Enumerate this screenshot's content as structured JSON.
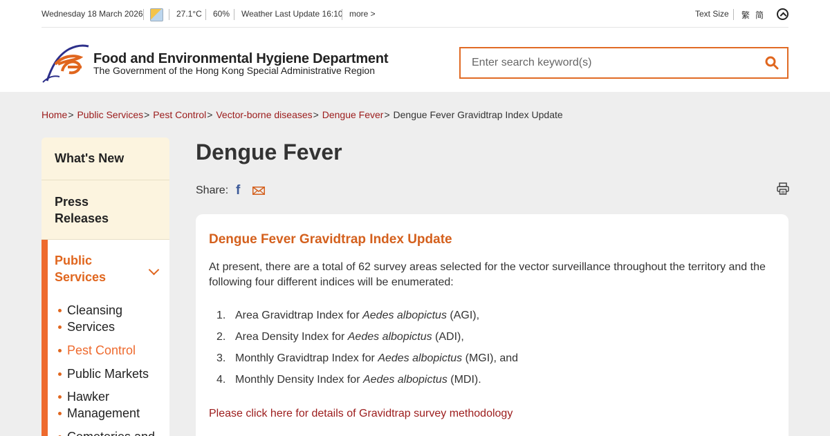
{
  "topbar": {
    "date": "Wednesday 18 March 2026",
    "weather_icon": "sunny-periods-icon",
    "temperature": "27.1°C",
    "humidity": "60%",
    "weather_update": "Weather Last Update 16:10",
    "more": "more >",
    "text_size": "Text Size",
    "lang_trad": "繁",
    "lang_simp": "简",
    "font_toggle_icon": "chevron-up-circle-icon"
  },
  "header": {
    "dept_name": "Food and Environmental Hygiene Department",
    "dept_sub": "The Government of the Hong Kong Special Administrative Region",
    "search_placeholder": "Enter search keyword(s)"
  },
  "breadcrumb": {
    "items": [
      "Home",
      "Public Services",
      "Pest Control",
      "Vector-borne diseases",
      "Dengue Fever"
    ],
    "separator": ">",
    "current": "Dengue Fever Gravidtrap Index Update"
  },
  "sidebar": {
    "whats_new": "What's New",
    "press_line1": "Press",
    "press_line2": "Releases",
    "public_line1": "Public",
    "public_line2": "Services",
    "sub_items": [
      {
        "line1": "Cleansing",
        "line2": "Services"
      },
      {
        "line1": "Pest Control"
      },
      {
        "line1": "Public Markets"
      },
      {
        "line1": "Hawker",
        "line2": "Management"
      },
      {
        "line1": "Cemeteries and"
      }
    ]
  },
  "content": {
    "page_title": "Dengue Fever",
    "share_label": "Share:",
    "card_title": "Dengue Fever Gravidtrap Index Update",
    "intro": "At present, there are a total of 62 survey areas selected for the vector surveillance throughout the territory and the following four different indices will be enumerated:",
    "indices": [
      {
        "num": "1.",
        "pre": "Area Gravidtrap Index for ",
        "species": "Aedes albopictus",
        "post": " (AGI),"
      },
      {
        "num": "2.",
        "pre": "Area Density Index for ",
        "species": "Aedes albopictus",
        "post": " (ADI),"
      },
      {
        "num": "3.",
        "pre": "Monthly Gravidtrap Index for ",
        "species": "Aedes albopictus",
        "post": " (MGI), and"
      },
      {
        "num": "4.",
        "pre": "Monthly Density Index for ",
        "species": "Aedes albopictus",
        "post": " (MDI)."
      }
    ],
    "methodology_link": "Please click here for details of Gravidtrap survey methodology"
  },
  "colors": {
    "accent_orange": "#e0661e",
    "link_red": "#9b1b1b",
    "sidebar_bg": "#fcf4df",
    "page_bg": "#eeeeee"
  }
}
